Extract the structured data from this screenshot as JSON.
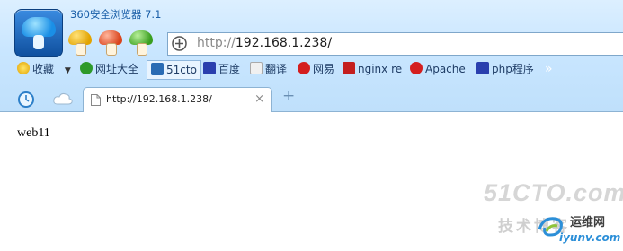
{
  "window": {
    "title": "360安全浏览器 7.1"
  },
  "address_bar": {
    "protocol": "http://",
    "url_rest": "192.168.1.238/"
  },
  "bookmarks": {
    "favorites": "收藏",
    "items": [
      "网址大全",
      "51cto",
      "百度",
      "翻译",
      "网易",
      "nginx re",
      "Apache",
      "php程序"
    ],
    "more": "»"
  },
  "tabs": [
    {
      "title": "http://192.168.1.238/"
    }
  ],
  "new_tab": "+",
  "content": {
    "text": "web11"
  },
  "watermark": {
    "site": "51CTO.com",
    "blog": "技术博客",
    "net": "运维网",
    "domain": "iyunv.com"
  },
  "colors": {
    "chrome_bg": "#c9e6ff",
    "accent": "#1a5fa8",
    "link": "#1f3d66"
  },
  "icons": [
    "360-logo",
    "mushroom-icon",
    "shield-icon",
    "star-icon",
    "page-icon",
    "alarm-icon",
    "cloud-icon"
  ]
}
